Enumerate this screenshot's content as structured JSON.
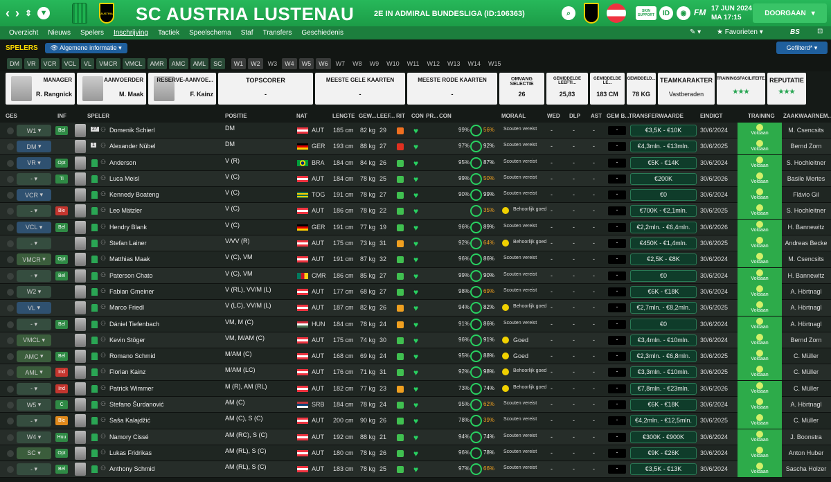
{
  "topbar": {
    "club_name": "SC AUSTRIA LUSTENAU",
    "subtitle": "2E IN ADMIRAL BUNDESLIGA (ID:106363)",
    "date_line1": "17 JUN 2024",
    "date_line2": "MA 17:15",
    "continue_label": "DOORGAAN",
    "skin_support": "SKIN SUPPORT",
    "crest_text": "AUSTRIA",
    "id_label": "ID",
    "fm_label": "FM"
  },
  "menu": [
    "Overzicht",
    "Nieuws",
    "Spelers",
    "Inschrijving",
    "Tactiek",
    "Speelschema",
    "Staf",
    "Transfers",
    "Geschiedenis"
  ],
  "favorites": "Favorieten",
  "bs_label": "BS",
  "subbar": {
    "section": "SPELERS",
    "view": "Algemene informatie",
    "filter": "Gefilterd*"
  },
  "positions": [
    "DM",
    "VR",
    "VCR",
    "VCL",
    "VL",
    "VMCR",
    "VMCL",
    "AMR",
    "AMC",
    "AML",
    "SC",
    "W1",
    "W2",
    "W3",
    "W4",
    "W5",
    "W6",
    "W7",
    "W8",
    "W9",
    "W10",
    "W11",
    "W12",
    "W13",
    "W14",
    "W15"
  ],
  "staff": {
    "manager": {
      "title": "MANAGER",
      "name": "R. Rangnick"
    },
    "captain": {
      "title": "AANVOERDER",
      "name": "M. Maak"
    },
    "vice": {
      "title": "RESERVE-AANVOE...",
      "name": "F. Kainz"
    },
    "topscorer": {
      "title": "TOPSCORER",
      "value": "-"
    },
    "yellow": {
      "title": "MEESTE GELE KAARTEN",
      "value": "-"
    },
    "red": {
      "title": "MEESTE RODE KAARTEN",
      "value": "-"
    },
    "squad": {
      "title": "OMVANG SELECTIE",
      "value": "26"
    },
    "avg_age": {
      "title": "GEMIDDELDE LEEFTI...",
      "value": "25,83"
    },
    "avg_len": {
      "title": "GEMIDDELDE LE...",
      "value": "183 CM"
    },
    "avg_wgt": {
      "title": "GEMIDDELD...",
      "value": "78 KG"
    },
    "char": {
      "title": "TEAMKARAKTER",
      "value": "Vastberaden"
    },
    "facilities": {
      "title": "TRAININGSFACILITEITE...",
      "value": "★★★"
    },
    "reputation": {
      "title": "REPUTATIE",
      "value": "★★★"
    }
  },
  "headers": {
    "ges": "GES",
    "inf": "INF",
    "speler": "SPELER",
    "positie": "POSITIE",
    "nat": "NAT",
    "lengte": "LENGTE",
    "gew": "GEW...",
    "leef": "LEEF...",
    "rit": "RIT",
    "con": "CON",
    "pr": "PR...",
    "con2": "CON",
    "moreel": "MORAAL",
    "wed": "WED",
    "dlp": "DLP",
    "ast": "AST",
    "gemb": "GEM B...",
    "tv": "TRANSFERWAARDE",
    "einde": "EINDIGT",
    "training": "TRAINING",
    "scout": "ZAAKWAARNEM..."
  },
  "players": [
    {
      "role": "W1",
      "tag": "Bel",
      "num": "27",
      "name": "Domenik Schierl",
      "pos": "DM",
      "nat": "AUT",
      "len": "185 cm",
      "wgt": "82 kg",
      "age": "29",
      "rit": "#f07020",
      "con": "99%",
      "m": "56%",
      "moraal": "Scouten vereist",
      "tv": "€3,5K - €10K",
      "end": "30/6/2024",
      "scout": "M. Csencsits"
    },
    {
      "role": "DM",
      "tag": "",
      "num": "1",
      "name": "Alexander Nübel",
      "pos": "DM",
      "nat": "GER",
      "len": "193 cm",
      "wgt": "88 kg",
      "age": "27",
      "rit": "#e03020",
      "con": "97%",
      "m": "92%",
      "moraal": "Scouten vereist",
      "tv": "€4,3mln. - €13mln.",
      "end": "30/6/2025",
      "scout": "Bernd Zorn"
    },
    {
      "role": "VR",
      "tag": "Opt",
      "num": "",
      "name": "Anderson",
      "pos": "V (R)",
      "nat": "BRA",
      "len": "184 cm",
      "wgt": "84 kg",
      "age": "26",
      "rit": "#40c050",
      "con": "95%",
      "m": "87%",
      "moraal": "Scouten vereist",
      "tv": "€5K - €14K",
      "end": "30/6/2024",
      "scout": "S. Hochleitner"
    },
    {
      "role": "-",
      "tag": "Ti",
      "num": "",
      "name": "Luca Meisl",
      "pos": "V (C)",
      "nat": "AUT",
      "len": "184 cm",
      "wgt": "78 kg",
      "age": "25",
      "rit": "#40c050",
      "con": "99%",
      "m": "50%",
      "moraal": "Scouten vereist",
      "tv": "€200K",
      "end": "30/6/2026",
      "scout": "Basile Mertes"
    },
    {
      "role": "VCR",
      "tag": "",
      "num": "",
      "name": "Kennedy Boateng",
      "pos": "V (C)",
      "nat": "TOG",
      "len": "191 cm",
      "wgt": "78 kg",
      "age": "27",
      "rit": "#40c050",
      "con": "90%",
      "m": "99%",
      "moraal": "Scouten vereist",
      "tv": "€0",
      "end": "30/6/2024",
      "scout": "Flávio Gil"
    },
    {
      "role": "-",
      "tag": "Ble",
      "num": "",
      "name": "Leo Mätzler",
      "pos": "V (C)",
      "nat": "AUT",
      "len": "186 cm",
      "wgt": "78 kg",
      "age": "22",
      "rit": "#40c050",
      "con": "",
      "m": "35%",
      "moraal": "Behoorlijk goed",
      "tv": "€700K - €2,1mln.",
      "end": "30/6/2025",
      "scout": "S. Hochleitner"
    },
    {
      "role": "VCL",
      "tag": "Bel",
      "num": "",
      "name": "Hendry Blank",
      "pos": "V (C)",
      "nat": "GER",
      "len": "191 cm",
      "wgt": "77 kg",
      "age": "19",
      "rit": "#40c050",
      "con": "96%",
      "m": "89%",
      "moraal": "Scouten vereist",
      "tv": "€2,2mln. - €6,4mln.",
      "end": "30/6/2026",
      "scout": "H. Bannewitz"
    },
    {
      "role": "-",
      "tag": "",
      "num": "",
      "name": "Stefan Lainer",
      "pos": "V/VV (R)",
      "nat": "AUT",
      "len": "175 cm",
      "wgt": "73 kg",
      "age": "31",
      "rit": "#f0a020",
      "con": "92%",
      "m": "64%",
      "moraal": "Behoorlijk goed",
      "tv": "€450K - €1,4mln.",
      "end": "30/6/2025",
      "scout": "Andreas Becke"
    },
    {
      "role": "VMCR",
      "tag": "Opt",
      "num": "",
      "name": "Matthias Maak",
      "pos": "V (C), VM",
      "nat": "AUT",
      "len": "191 cm",
      "wgt": "87 kg",
      "age": "32",
      "rit": "#40c050",
      "con": "96%",
      "m": "86%",
      "moraal": "Scouten vereist",
      "tv": "€2,5K - €8K",
      "end": "30/6/2024",
      "scout": "M. Csencsits"
    },
    {
      "role": "-",
      "tag": "Bel",
      "num": "",
      "name": "Paterson Chato",
      "pos": "V (C), VM",
      "nat": "CMR",
      "len": "186 cm",
      "wgt": "85 kg",
      "age": "27",
      "rit": "#40c050",
      "con": "99%",
      "m": "90%",
      "moraal": "Scouten vereist",
      "tv": "€0",
      "end": "30/6/2024",
      "scout": "H. Bannewitz"
    },
    {
      "role": "W2",
      "tag": "",
      "num": "",
      "name": "Fabian Gmeiner",
      "pos": "V (RL), VV/M (L)",
      "nat": "AUT",
      "len": "177 cm",
      "wgt": "68 kg",
      "age": "27",
      "rit": "#40c050",
      "con": "98%",
      "m": "69%",
      "moraal": "Scouten vereist",
      "tv": "€6K - €18K",
      "end": "30/6/2024",
      "scout": "A. Hörtnagl"
    },
    {
      "role": "VL",
      "tag": "",
      "num": "",
      "name": "Marco Friedl",
      "pos": "V (LC), VV/M (L)",
      "nat": "AUT",
      "len": "187 cm",
      "wgt": "82 kg",
      "age": "26",
      "rit": "#f0a020",
      "con": "94%",
      "m": "82%",
      "moraal": "Behoorlijk goed",
      "tv": "€2,7mln. - €8,2mln.",
      "end": "30/6/2025",
      "scout": "A. Hörtnagl"
    },
    {
      "role": "-",
      "tag": "Bel",
      "num": "",
      "name": "Dániel Tiefenbach",
      "pos": "VM, M (C)",
      "nat": "HUN",
      "len": "184 cm",
      "wgt": "78 kg",
      "age": "24",
      "rit": "#f0a020",
      "con": "91%",
      "m": "86%",
      "moraal": "Scouten vereist",
      "tv": "€0",
      "end": "30/6/2024",
      "scout": "A. Hörtnagl"
    },
    {
      "role": "VMCL",
      "tag": "",
      "num": "",
      "name": "Kevin Stöger",
      "pos": "VM, M/AM (C)",
      "nat": "AUT",
      "len": "175 cm",
      "wgt": "74 kg",
      "age": "30",
      "rit": "#40c050",
      "con": "96%",
      "m": "91%",
      "moraal": "Goed",
      "tv": "€3,4mln. - €10mln.",
      "end": "30/6/2024",
      "scout": "Bernd Zorn"
    },
    {
      "role": "AMC",
      "tag": "Bel",
      "num": "",
      "name": "Romano Schmid",
      "pos": "M/AM (C)",
      "nat": "AUT",
      "len": "168 cm",
      "wgt": "69 kg",
      "age": "24",
      "rit": "#40c050",
      "con": "95%",
      "m": "88%",
      "moraal": "Goed",
      "tv": "€2,3mln. - €6,8mln.",
      "end": "30/6/2025",
      "scout": "C. Müller"
    },
    {
      "role": "AML",
      "tag": "Ind",
      "num": "",
      "name": "Florian Kainz",
      "pos": "M/AM (LC)",
      "nat": "AUT",
      "len": "176 cm",
      "wgt": "71 kg",
      "age": "31",
      "rit": "#40c050",
      "con": "92%",
      "m": "98%",
      "moraal": "Behoorlijk goed",
      "tv": "€3,3mln. - €10mln.",
      "end": "30/6/2025",
      "scout": "C. Müller"
    },
    {
      "role": "-",
      "tag": "Ind",
      "num": "",
      "name": "Patrick Wimmer",
      "pos": "M (R), AM (RL)",
      "nat": "AUT",
      "len": "182 cm",
      "wgt": "77 kg",
      "age": "23",
      "rit": "#f0a020",
      "con": "73%",
      "m": "74%",
      "moraal": "Behoorlijk goed",
      "tv": "€7,8mln. - €23mln.",
      "end": "30/6/2026",
      "scout": "C. Müller"
    },
    {
      "role": "W5",
      "tag": "C",
      "num": "",
      "name": "Stefano Šurdanović",
      "pos": "AM (C)",
      "nat": "SRB",
      "len": "184 cm",
      "wgt": "78 kg",
      "age": "24",
      "rit": "#40c050",
      "con": "95%",
      "m": "62%",
      "moraal": "Scouten vereist",
      "tv": "€6K - €18K",
      "end": "30/6/2024",
      "scout": "A. Hörtnagl"
    },
    {
      "role": "-",
      "tag": "Ble",
      "num": "",
      "name": "Saša Kalajdžić",
      "pos": "AM (C), S (C)",
      "nat": "AUT",
      "len": "200 cm",
      "wgt": "90 kg",
      "age": "26",
      "rit": "#40c050",
      "con": "78%",
      "m": "39%",
      "moraal": "Scouten vereist",
      "tv": "€4,2mln. - €12,5mln.",
      "end": "30/6/2025",
      "scout": "C. Müller"
    },
    {
      "role": "W4",
      "tag": "Huu",
      "num": "",
      "name": "Namory Cissé",
      "pos": "AM (RC), S (C)",
      "nat": "AUT",
      "len": "192 cm",
      "wgt": "88 kg",
      "age": "21",
      "rit": "#40c050",
      "con": "94%",
      "m": "74%",
      "moraal": "Scouten vereist",
      "tv": "€300K - €900K",
      "end": "30/6/2024",
      "scout": "J. Boonstra"
    },
    {
      "role": "SC",
      "tag": "Opt",
      "num": "",
      "name": "Lukas Fridrikas",
      "pos": "AM (RL), S (C)",
      "nat": "AUT",
      "len": "180 cm",
      "wgt": "78 kg",
      "age": "26",
      "rit": "#40c050",
      "con": "96%",
      "m": "78%",
      "moraal": "Scouten vereist",
      "tv": "€9K - €26K",
      "end": "30/6/2024",
      "scout": "Anton Huber"
    },
    {
      "role": "-",
      "tag": "Bel",
      "num": "",
      "name": "Anthony Schmid",
      "pos": "AM (RL), S (C)",
      "nat": "AUT",
      "len": "183 cm",
      "wgt": "78 kg",
      "age": "25",
      "rit": "#40c050",
      "con": "97%",
      "m": "66%",
      "moraal": "Scouten vereist",
      "tv": "€3,5K - €13K",
      "end": "30/6/2024",
      "scout": "Sascha Holzer"
    }
  ],
  "training_label": "Voldaan"
}
